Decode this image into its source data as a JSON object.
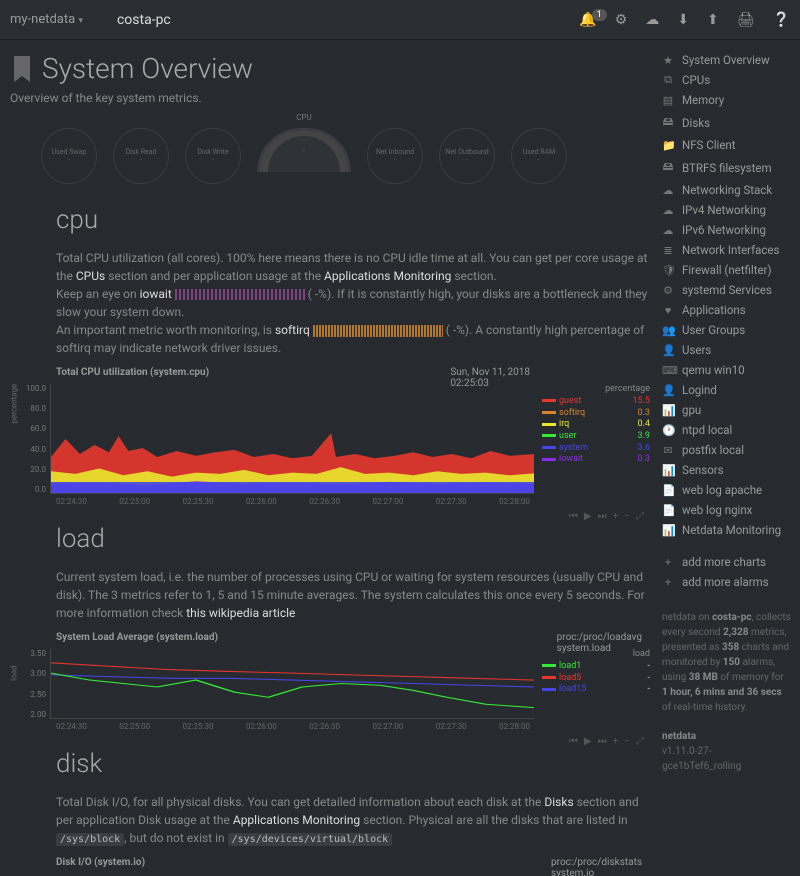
{
  "topbar": {
    "brand": "my-netdata",
    "hostname": "costa-pc",
    "alarm_count": "1"
  },
  "header": {
    "title": "System Overview",
    "subtitle": "Overview of the key system metrics."
  },
  "gauges": {
    "items": [
      {
        "label": "Used Swap",
        "sub": "-"
      },
      {
        "label": "Disk Read",
        "sub": "-"
      },
      {
        "label": "Disk Write",
        "sub": "-"
      },
      {
        "label": "CPU",
        "sub": "-"
      },
      {
        "label": "Net Inbound",
        "sub": "-"
      },
      {
        "label": "Net Outbound",
        "sub": "-"
      },
      {
        "label": "Used RAM",
        "sub": "-"
      }
    ]
  },
  "cpu": {
    "heading": "cpu",
    "p1a": "Total CPU utilization (all cores). 100% here means there is no CPU idle time at all. You can get per core usage at the ",
    "p1b": "CPUs",
    "p1c": " section and per application usage at the ",
    "p1d": "Applications Monitoring",
    "p1e": " section.",
    "p2a": "Keep an eye on ",
    "p2b": "iowait",
    "p2c": " ( ",
    "p2d": "-%). If it is constantly high, your disks are a bottleneck and they slow your system down.",
    "p3a": "An important metric worth monitoring, is ",
    "p3b": "softirq",
    "p3c": " ( ",
    "p3d": "-%). A constantly high percentage of softirq may indicate network driver issues.",
    "chart": {
      "title": "Total CPU utilization (system.cpu)",
      "date_line1": "Sun, Nov 11, 2018",
      "date_line2": "02:25:03",
      "unit": "percentage",
      "yticks": [
        "100.0",
        "80.0",
        "60.0",
        "40.0",
        "20.0",
        "0.0"
      ],
      "ylabel": "percentage",
      "legend": [
        {
          "name": "guest",
          "value": "15.5",
          "color": "#E8362D"
        },
        {
          "name": "softirq",
          "value": "0.3",
          "color": "#D8842D"
        },
        {
          "name": "irq",
          "value": "0.4",
          "color": "#E8E82D"
        },
        {
          "name": "user",
          "value": "3.9",
          "color": "#36E836"
        },
        {
          "name": "system",
          "value": "3.6",
          "color": "#4545E8"
        },
        {
          "name": "iowait",
          "value": "0.3",
          "color": "#8B2DE8"
        }
      ],
      "xticks": [
        "02:24:30",
        "02:25:00",
        "02:25:30",
        "02:26:00",
        "02:26:30",
        "02:27:00",
        "02:27:30",
        "02:28:00"
      ]
    }
  },
  "load": {
    "heading": "load",
    "p1a": "Current system load, i.e. the number of processes using CPU or waiting for system resources (usually CPU and disk). The 3 metrics refer to 1, 5 and 15 minute averages. The system calculates this once every 5 seconds. For more information check ",
    "p1b": "this wikipedia article",
    "chart": {
      "title": "System Load Average (system.load)",
      "source": "proc:/proc/loadavg",
      "context": "system.load",
      "unit": "load",
      "ylabel": "load",
      "yticks": [
        "3.50",
        "3.00",
        "2.50",
        "2.00"
      ],
      "legend": [
        {
          "name": "load1",
          "value": "-",
          "color": "#36E836"
        },
        {
          "name": "load5",
          "value": "-",
          "color": "#E8362D"
        },
        {
          "name": "load15",
          "value": "-",
          "color": "#4545E8"
        }
      ],
      "xticks": [
        "02:24:30",
        "02:25:00",
        "02:25:30",
        "02:26:00",
        "02:26:30",
        "02:27:00",
        "02:27:30",
        "02:28:00"
      ]
    }
  },
  "disk": {
    "heading": "disk",
    "p1a": "Total Disk I/O, for all physical disks. You can get detailed information about each disk at the ",
    "p1b": "Disks",
    "p1c": " section and per application Disk usage at the ",
    "p1d": "Applications Monitoring",
    "p1e": " section. Physical are all the disks that are listed in ",
    "path1": "/sys/block",
    "p1f": ", but do not exist in ",
    "path2": "/sys/devices/virtual/block",
    "chart": {
      "title": "Disk I/O (system.io)",
      "source": "proc:/proc/diskstats",
      "context": "system.io"
    }
  },
  "chart_data": [
    {
      "type": "area",
      "title": "Total CPU utilization (system.cpu)",
      "ylabel": "percentage",
      "ylim": [
        0,
        100
      ],
      "x": [
        "02:24:30",
        "02:25:00",
        "02:25:30",
        "02:26:00",
        "02:26:30",
        "02:27:00",
        "02:27:30",
        "02:28:00"
      ],
      "series": [
        {
          "name": "guest",
          "values": [
            45,
            55,
            48,
            42,
            38,
            40,
            58,
            40,
            38,
            42,
            40,
            38,
            45,
            40
          ]
        },
        {
          "name": "softirq",
          "values": [
            0.3,
            0.3,
            0.3,
            0.3,
            0.3,
            0.3,
            0.3,
            0.3,
            0.3,
            0.3,
            0.3,
            0.3,
            0.3,
            0.3
          ]
        },
        {
          "name": "irq",
          "values": [
            0.4,
            0.4,
            0.4,
            0.4,
            0.4,
            0.4,
            0.4,
            0.4,
            0.4,
            0.4,
            0.4,
            0.4,
            0.4,
            0.4
          ]
        },
        {
          "name": "user",
          "values": [
            4,
            5,
            4,
            4,
            3,
            4,
            5,
            4,
            4,
            4,
            4,
            3,
            4,
            4
          ]
        },
        {
          "name": "system",
          "values": [
            4,
            4,
            3,
            4,
            3,
            4,
            4,
            3,
            4,
            4,
            3,
            4,
            4,
            3
          ]
        },
        {
          "name": "iowait",
          "values": [
            3,
            6,
            2,
            5,
            3,
            4,
            6,
            3,
            4,
            3,
            5,
            4,
            3,
            4
          ]
        }
      ]
    },
    {
      "type": "line",
      "title": "System Load Average (system.load)",
      "ylabel": "load",
      "ylim": [
        2.0,
        3.5
      ],
      "x": [
        "02:24:30",
        "02:25:00",
        "02:25:30",
        "02:26:00",
        "02:26:30",
        "02:27:00",
        "02:27:30",
        "02:28:00"
      ],
      "series": [
        {
          "name": "load1",
          "values": [
            3.05,
            2.85,
            2.7,
            2.8,
            2.45,
            2.75,
            2.7,
            2.25
          ]
        },
        {
          "name": "load5",
          "values": [
            3.35,
            3.3,
            3.25,
            3.2,
            3.15,
            3.1,
            3.05,
            3.0
          ]
        },
        {
          "name": "load15",
          "values": [
            3.05,
            3.0,
            2.95,
            2.92,
            2.88,
            2.85,
            2.8,
            2.75
          ]
        }
      ]
    }
  ],
  "sidebar": {
    "items": [
      {
        "icon": "★",
        "label": "System Overview"
      },
      {
        "icon": "⧉",
        "label": "CPUs"
      },
      {
        "icon": "▤",
        "label": "Memory"
      },
      {
        "icon": "🖴",
        "label": "Disks"
      },
      {
        "icon": "📁",
        "label": "NFS Client"
      },
      {
        "icon": "🖴",
        "label": "BTRFS filesystem"
      },
      {
        "icon": "☁",
        "label": "Networking Stack"
      },
      {
        "icon": "☁",
        "label": "IPv4 Networking"
      },
      {
        "icon": "☁",
        "label": "IPv6 Networking"
      },
      {
        "icon": "≣",
        "label": "Network Interfaces"
      },
      {
        "icon": "🛡",
        "label": "Firewall (netfilter)"
      },
      {
        "icon": "⚙",
        "label": "systemd Services"
      },
      {
        "icon": "♥",
        "label": "Applications"
      },
      {
        "icon": "👥",
        "label": "User Groups"
      },
      {
        "icon": "👤",
        "label": "Users"
      },
      {
        "icon": "⌨",
        "label": "qemu win10"
      },
      {
        "icon": "👤",
        "label": "Logind"
      },
      {
        "icon": "📊",
        "label": "gpu"
      },
      {
        "icon": "🕐",
        "label": "ntpd local"
      },
      {
        "icon": "✉",
        "label": "postfix local"
      },
      {
        "icon": "📊",
        "label": "Sensors"
      },
      {
        "icon": "📄",
        "label": "web log apache"
      },
      {
        "icon": "📄",
        "label": "web log nginx"
      },
      {
        "icon": "📊",
        "label": "Netdata Monitoring"
      }
    ],
    "add_charts": "add more charts",
    "add_alarms": "add more alarms",
    "footer": {
      "l1a": "netdata on ",
      "l1b": "costa-pc",
      "l1c": ", collects every second ",
      "l1d": "2,328",
      "l1e": " metrics, presented as ",
      "l1f": "358",
      "l1g": " charts and monitored by ",
      "l1h": "150",
      "l1i": " alarms, using ",
      "l1j": "38 MB",
      "l1k": " of memory for ",
      "l1l": "1 hour, 6 mins and 36 secs",
      "l1m": " of real-time history.",
      "ver_label": "netdata",
      "ver1": "v1.11.0-27-",
      "ver2": "gce1bTef6_rolling"
    }
  }
}
